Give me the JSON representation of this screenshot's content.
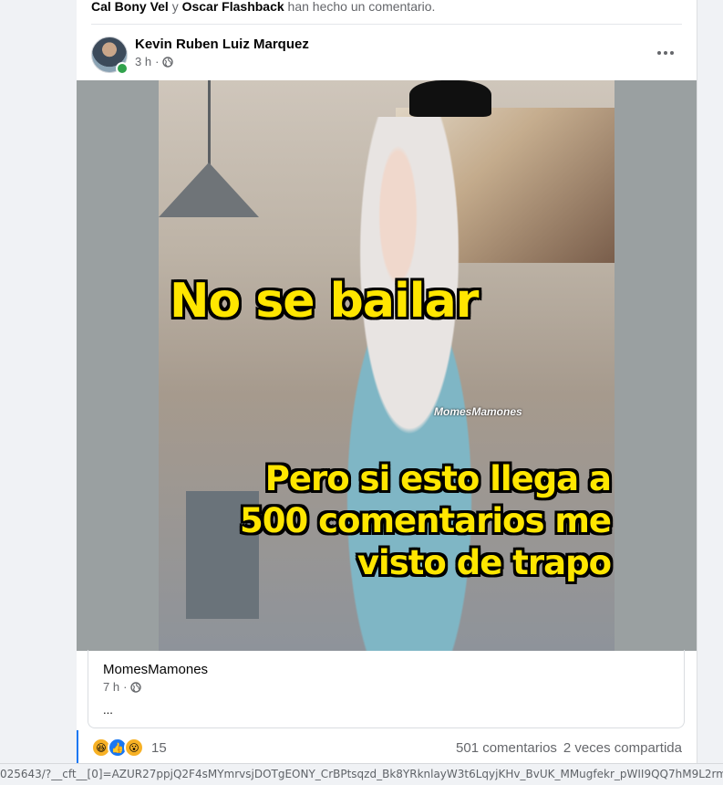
{
  "activity": {
    "user1": "Cal Bony Vel",
    "joiner": "y",
    "user2": "Oscar Flashback",
    "suffix": "han hecho un comentario."
  },
  "post": {
    "author": "Kevin Ruben Luiz Marquez",
    "time": "3 h",
    "separator": "·",
    "audience_icon": "globe-icon",
    "more_icon": "more-options-icon"
  },
  "image": {
    "caption_top": "No se bailar",
    "caption_bottom": [
      "Pero si esto llega a",
      "500 comentarios me",
      "visto de trapo"
    ],
    "watermark": "MomesMamones",
    "colors": {
      "caption": "#ffe600",
      "outline": "#000000"
    }
  },
  "shared": {
    "page_name": "MomesMamones",
    "time": "7 h",
    "separator": "·",
    "ellipsis": "..."
  },
  "stats": {
    "reactions": [
      "haha",
      "like",
      "wow"
    ],
    "reaction_count": "15",
    "comments": "501 comentarios",
    "shares": "2 veces compartida"
  },
  "status_url": "025643/?__cft__[0]=AZUR27ppjQ2F4sMYmrvsjDOTgEONY_CrBPtsqzd_Bk8YRknlayW3t6LqyjKHv_BvUK_MMugfekr_pWII9QQ7hM9L2rmcogC104",
  "colors": {
    "accent": "#1877f2",
    "secondary_text": "#65676b",
    "online": "#31a24c"
  }
}
